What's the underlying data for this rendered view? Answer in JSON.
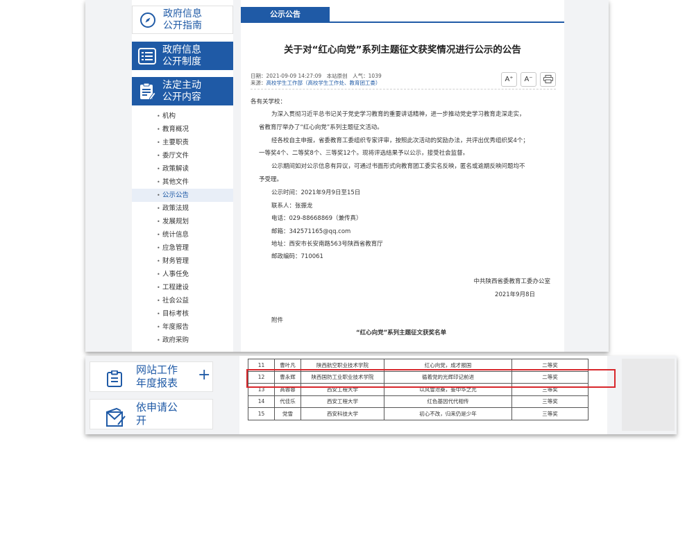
{
  "sidebar": {
    "cards": [
      {
        "line1": "政府信息",
        "line2": "公开指南",
        "icon": "compass-icon"
      },
      {
        "line1": "政府信息",
        "line2": "公开制度",
        "icon": "list-icon"
      },
      {
        "line1": "法定主动",
        "line2": "公开内容",
        "icon": "clipboard-edit-icon"
      }
    ],
    "menu": [
      "机构",
      "教育概况",
      "主要职责",
      "委厅文件",
      "政策解读",
      "其他文件",
      "公示公告",
      "政策法规",
      "发展规划",
      "统计信息",
      "应急管理",
      "财务管理",
      "人事任免",
      "工程建设",
      "社会公益",
      "目标考核",
      "年度报告",
      "政府采购"
    ],
    "active_item": "公示公告"
  },
  "content": {
    "tab_label": "公示公告",
    "title": "关于对“红心向党”系列主题征文获奖情况进行公示的公告",
    "meta": {
      "date_line": "日期：2021-09-09 14:27:09　本站原创　人气：1039",
      "source_label": "来源：",
      "source": "高校学生工作部（高校学生工作处、教育团工委）"
    },
    "tools": {
      "font_larger": "A⁺",
      "font_smaller": "A⁻",
      "print_icon": "printer-icon"
    },
    "body": {
      "greeting": "各有关学校：",
      "p1_l1": "为深入贯彻习近平总书记关于党史学习教育的重要讲话精神，进一步推动党史学习教育走深走实，",
      "p1_l2": "省教育厅举办了“红心向党”系列主题征文活动。",
      "p2_l1": "经各校自主申报，省委教育工委组织专家评审，按照此次活动的奖励办法，共评出优秀组织奖4个；",
      "p2_l2": "一等奖4个、二等奖8个、三等奖12个。现将评选结果予以公示，接受社会监督。",
      "p3_l1": "公示期间如对公示信息有异议，可通过书面形式向教育团工委实名反映，匿名或逾期反映问题均不",
      "p3_l2": "予受理。",
      "period": "公示时间：2021年9月9日至15日",
      "contact": "联系人：张振龙",
      "phone": "电话：029-88668869（兼传真）",
      "email": "邮箱：342571165@qq.com",
      "address": "地址：西安市长安南路563号陕西省教育厅",
      "postcode": "邮政编码：710061",
      "signature_org": "中共陕西省委教育工委办公室",
      "signature_date": "2021年9月8日",
      "attachment": "附件",
      "list_title": "“红心向党”系列主题征文获奖名单"
    }
  },
  "bottom_sidebar": [
    {
      "line1": "网站工作",
      "line2": "年度报表",
      "icon": "report-icon",
      "expand": "+"
    },
    {
      "line1": "依申请公",
      "line2": "开",
      "icon": "apply-icon",
      "expand": ""
    }
  ],
  "award_table": {
    "rows": [
      {
        "no": "11",
        "name": "曹叶凡",
        "school": "陕西航空职业技术学院",
        "work": "红心向党，成才报国",
        "prize": "二等奖"
      },
      {
        "no": "12",
        "name": "曹永辉",
        "school": "陕西国防工业职业技术学院",
        "work": "循着党的光辉印记前进",
        "prize": "二等奖"
      },
      {
        "no": "13",
        "name": "高蓉蓉",
        "school": "西安工程大学",
        "work": "以风雪沧桑，鉴中华之光",
        "prize": "三等奖"
      },
      {
        "no": "14",
        "name": "代佳乐",
        "school": "西安工程大学",
        "work": "红色基因代代相传",
        "prize": "三等奖"
      },
      {
        "no": "15",
        "name": "党雪",
        "school": "西安科技大学",
        "work": "初心不改，归来仍是少年",
        "prize": "三等奖"
      }
    ],
    "highlighted_row": 1,
    "highlight_color": "#d8262b"
  },
  "colors": {
    "accent": "#1f5aa6",
    "highlight": "#d8262b"
  }
}
